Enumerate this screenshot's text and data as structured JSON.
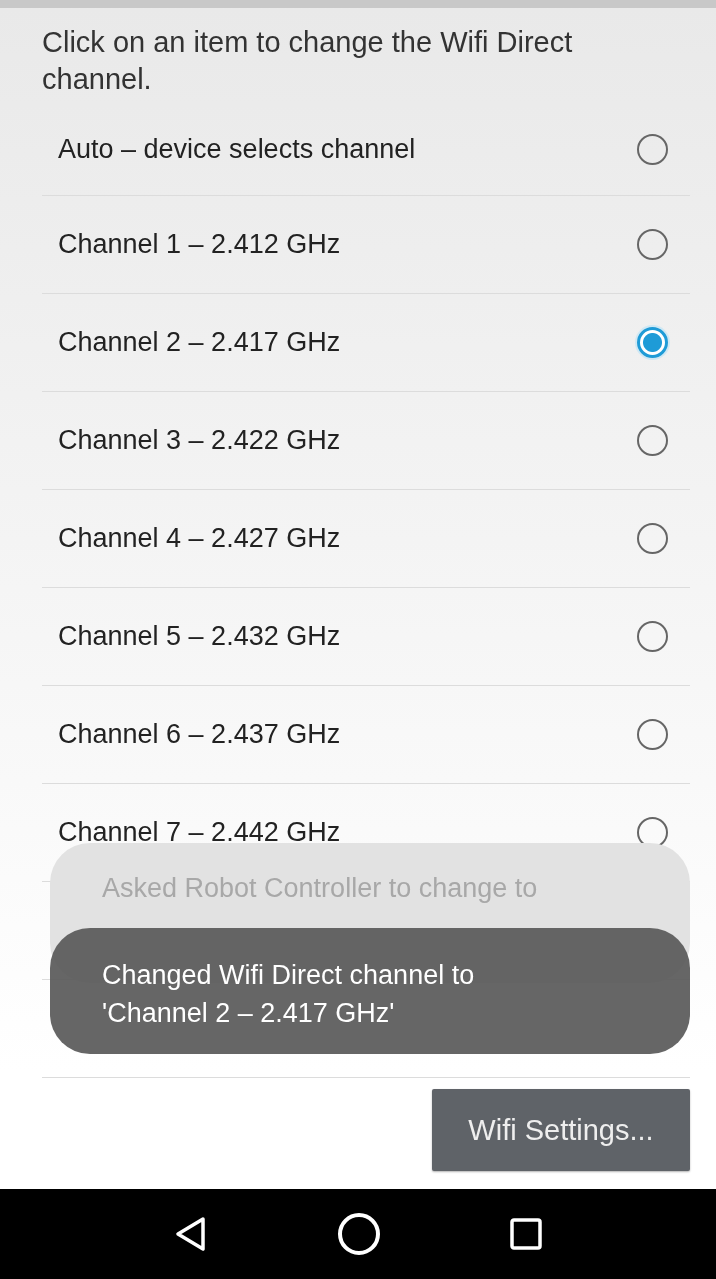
{
  "instruction": "Click on an item to change the Wifi Direct channel.",
  "channels": [
    {
      "label": "Auto – device selects channel",
      "selected": false
    },
    {
      "label": "Channel 1 – 2.412 GHz",
      "selected": false
    },
    {
      "label": "Channel 2 – 2.417 GHz",
      "selected": true
    },
    {
      "label": "Channel 3 – 2.422 GHz",
      "selected": false
    },
    {
      "label": "Channel 4 – 2.427 GHz",
      "selected": false
    },
    {
      "label": "Channel 5 – 2.432 GHz",
      "selected": false
    },
    {
      "label": "Channel 6 – 2.437 GHz",
      "selected": false
    },
    {
      "label": "Channel 7 – 2.442 GHz",
      "selected": false
    }
  ],
  "toasts": [
    {
      "text": "Asked Robot Controller to change to",
      "faded": true
    },
    {
      "text": "Changed Wifi Direct channel to 'Channel 2 – 2.417 GHz'",
      "faded": false
    }
  ],
  "button": "Wifi Settings..."
}
